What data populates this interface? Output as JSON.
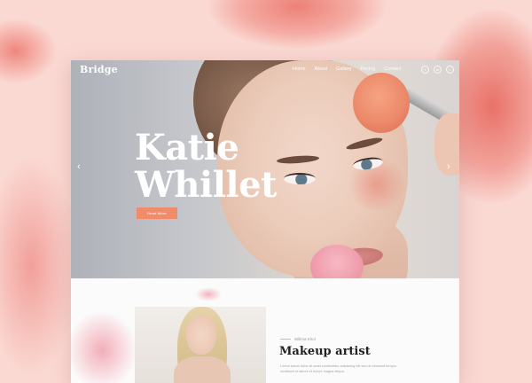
{
  "brand": {
    "logo": "Bridge",
    "accent_color": "#f08c6a",
    "backdrop_color": "#fbd9d3"
  },
  "nav": {
    "items": [
      "Home",
      "About",
      "Gallery",
      "Pricing",
      "Contact"
    ],
    "social_icons": [
      "facebook-icon",
      "instagram-icon",
      "pinterest-icon"
    ],
    "social_glyphs": [
      "f",
      "in",
      "p"
    ]
  },
  "hero": {
    "title_line1": "Katie",
    "title_line2": "Whillet",
    "button_label": "Read More",
    "prev_arrow": "‹",
    "next_arrow": "›"
  },
  "about": {
    "author": "Willma Khol",
    "title": "Makeup artist",
    "text": "Lorem ipsum dolor sit amet consectetur adipiscing elit sed do eiusmod tempor incididunt ut labore et dolore magna aliqua."
  }
}
